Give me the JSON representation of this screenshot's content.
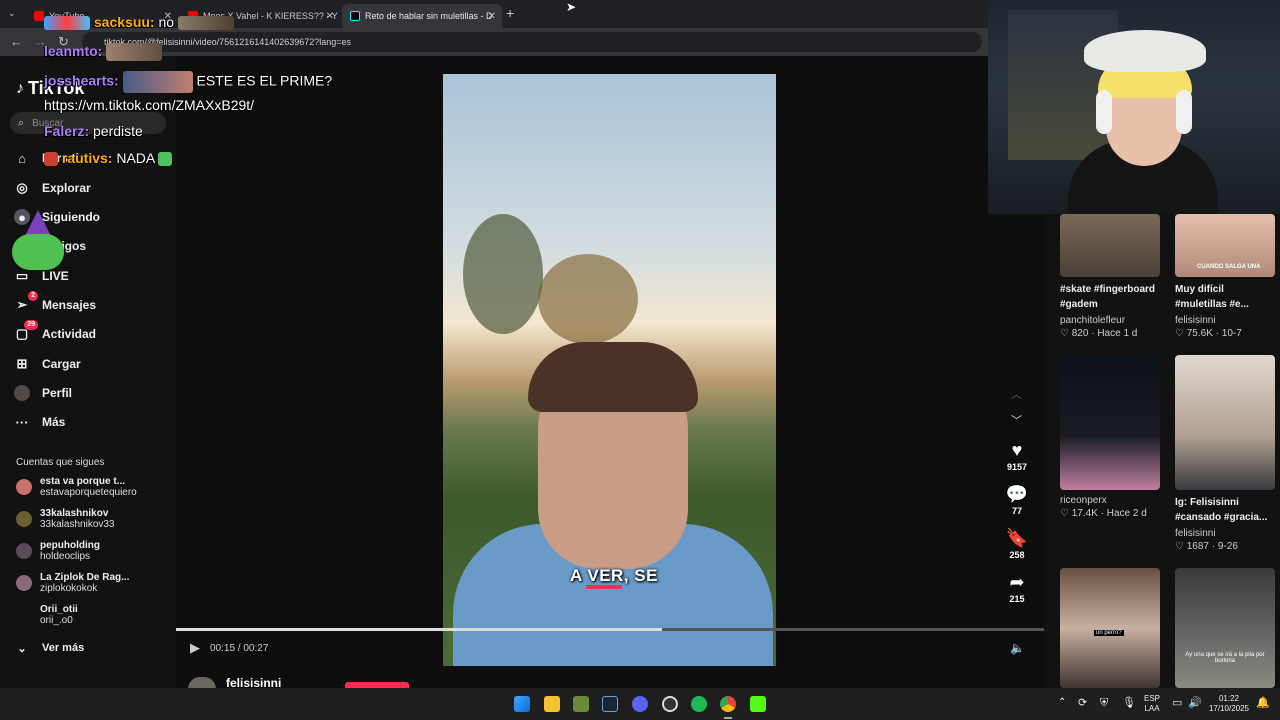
{
  "browser": {
    "tabs": [
      {
        "label": "YouTube"
      },
      {
        "label": "Moos X Vahel - K KIERESS?? - Y"
      },
      {
        "label": "Reto de hablar sin muletillas - D"
      }
    ],
    "url": "tiktok.com/@felisisinni/video/7561216141402639672?lang=es"
  },
  "sidebar": {
    "logo": "TikTok",
    "search_placeholder": "Buscar",
    "items": [
      {
        "label": "Para ti"
      },
      {
        "label": "Explorar"
      },
      {
        "label": "Siguiendo"
      },
      {
        "label": "Amigos"
      },
      {
        "label": "LIVE"
      },
      {
        "label": "Mensajes",
        "badge": "2"
      },
      {
        "label": "Actividad",
        "badge": "29"
      },
      {
        "label": "Cargar"
      },
      {
        "label": "Perfil"
      },
      {
        "label": "Más"
      }
    ],
    "following_header": "Cuentas que sigues",
    "following": [
      {
        "name": "esta va porque t...",
        "handle": "estavaporquetequiero"
      },
      {
        "name": "33kalashnikov",
        "handle": "33kalashnikov33"
      },
      {
        "name": "pepuholding",
        "handle": "holdeoclips"
      },
      {
        "name": "La Ziplok De Rag...",
        "handle": "ziplokokokok"
      },
      {
        "name": "Orii_otii",
        "handle": "orii_.o0"
      }
    ],
    "see_more": "Ver más"
  },
  "video": {
    "subtitle": "A VER, SE",
    "time": "00:15 / 00:27",
    "progress": 0.56,
    "author": "felisisinni"
  },
  "actions": {
    "likes": "9157",
    "comments": "77",
    "saves": "258",
    "shares": "215"
  },
  "related": [
    {
      "title": "#skate #fingerboard #gadem",
      "user": "panchitolefleur",
      "meta": "820 · Hace 1 d"
    },
    {
      "title": "Muy difícil #muletillas #e...",
      "user": "felisisinni",
      "meta": "75.6K · 10-7",
      "overlay": "CUANDO SALGA UNA"
    },
    {
      "title": "",
      "user": "riceonperx",
      "meta": "17.4K · Hace 2 d"
    },
    {
      "title": "Ig: Felisisinni #cansado #gracia...",
      "user": "felisisinni",
      "meta": "1687 · 9-26"
    },
    {
      "title": "",
      "user": "",
      "meta": "",
      "overlay": "un perro?"
    },
    {
      "title": "",
      "user": "",
      "meta": "",
      "overlay": "Ay una que se irá a la pila por burlona"
    }
  ],
  "chat": [
    {
      "user": "sacksuu:",
      "msg": "no"
    },
    {
      "user": "leanmto:",
      "msg": ""
    },
    {
      "user": "josshearts:",
      "msg": "ESTE ES EL PRIME?"
    },
    {
      "user": "",
      "msg": "https://vm.tiktok.com/ZMAXxB29t/"
    },
    {
      "user": "Falerz:",
      "msg": "perdiste"
    },
    {
      "user": "rautivs:",
      "msg": "NADA"
    }
  ],
  "taskbar": {
    "lang_top": "ESP",
    "lang_bottom": "LAA",
    "time": "01:22",
    "date": "17/10/2025"
  },
  "colors": {
    "accent": "#fe2c55",
    "background": "#121212",
    "chat_user_purple": "#b07bff",
    "chat_user_gold": "#ffb000"
  }
}
